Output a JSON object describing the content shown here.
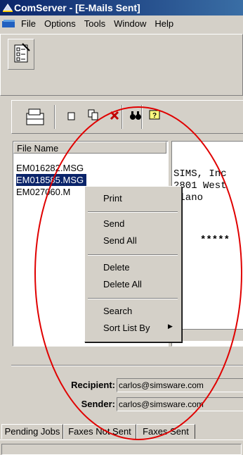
{
  "window": {
    "title": "ComServer - [E-Mails Sent]"
  },
  "menu": [
    "File",
    "Options",
    "Tools",
    "Window",
    "Help"
  ],
  "file_list": {
    "header": "File Name",
    "rows": [
      "EM016282.MSG",
      "EM018585.MSG",
      "EM027060.M"
    ],
    "selected_index": 1
  },
  "preview_lines": [
    "SIMS, Inc",
    "2801 West",
    "Plano",
    "*****"
  ],
  "context_menu": {
    "items": [
      "Print",
      "Send",
      "Send All",
      "Delete",
      "Delete All",
      "Search",
      "Sort List By"
    ],
    "submenu_arrow": "▶"
  },
  "details": {
    "recipient_label": "Recipient:",
    "recipient_value": "carlos@simsware.com",
    "sender_label": "Sender:",
    "sender_value": "carlos@simsware.com"
  },
  "tabs": [
    "Pending Jobs",
    "Faxes Not Sent",
    "Faxes Sent"
  ],
  "annotation": {
    "color": "#e00000"
  }
}
